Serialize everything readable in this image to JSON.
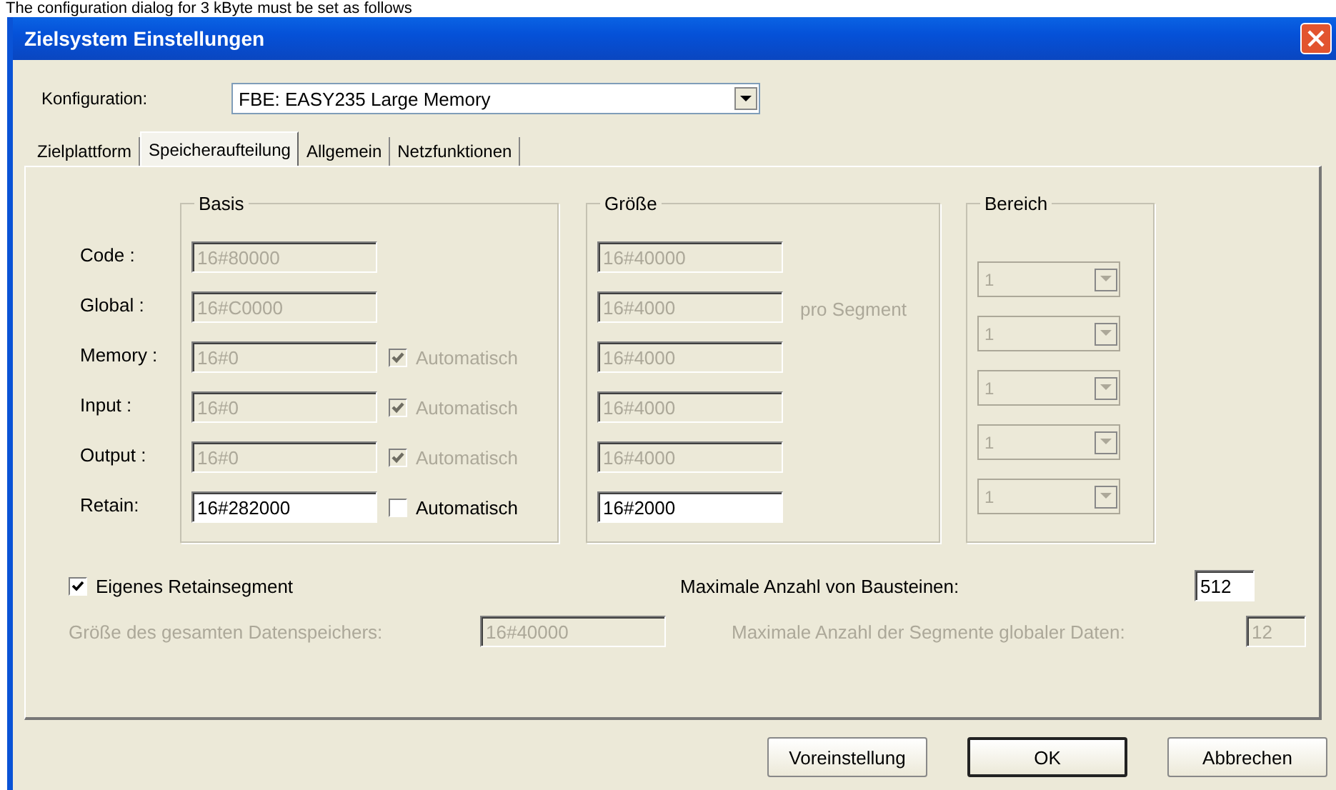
{
  "caption": "The configuration dialog for 3 kByte must be set as follows",
  "window": {
    "title": "Zielsystem Einstellungen"
  },
  "configuration": {
    "label": "Konfiguration:",
    "value": "FBE: EASY235 Large Memory"
  },
  "tabs": [
    {
      "label": "Zielplattform",
      "selected": false
    },
    {
      "label": "Speicheraufteilung",
      "selected": true
    },
    {
      "label": "Allgemein",
      "selected": false
    },
    {
      "label": "Netzfunktionen",
      "selected": false
    }
  ],
  "groups": {
    "basis": "Basis",
    "size": "Größe",
    "range": "Bereich"
  },
  "rows": [
    {
      "label": "Code :",
      "basis": {
        "value": "16#80000",
        "disabled": true
      },
      "size": {
        "value": "16#40000",
        "disabled": true
      }
    },
    {
      "label": "Global :",
      "basis": {
        "value": "16#C0000",
        "disabled": true
      },
      "size": {
        "value": "16#4000",
        "disabled": true
      },
      "note": "pro Segment"
    },
    {
      "label": "Memory :",
      "basis": {
        "value": "16#0",
        "disabled": true
      },
      "auto": {
        "label": "Automatisch",
        "checked": true,
        "disabled": true
      },
      "size": {
        "value": "16#4000",
        "disabled": true
      }
    },
    {
      "label": "Input :",
      "basis": {
        "value": "16#0",
        "disabled": true
      },
      "auto": {
        "label": "Automatisch",
        "checked": true,
        "disabled": true
      },
      "size": {
        "value": "16#4000",
        "disabled": true
      }
    },
    {
      "label": "Output :",
      "basis": {
        "value": "16#0",
        "disabled": true
      },
      "auto": {
        "label": "Automatisch",
        "checked": true,
        "disabled": true
      },
      "size": {
        "value": "16#4000",
        "disabled": true
      }
    },
    {
      "label": "Retain:",
      "basis": {
        "value": "16#282000",
        "disabled": false
      },
      "auto": {
        "label": "Automatisch",
        "checked": false,
        "disabled": false
      },
      "size": {
        "value": "16#2000",
        "disabled": false
      }
    }
  ],
  "ranges": [
    {
      "value": "1",
      "disabled": true
    },
    {
      "value": "1",
      "disabled": true
    },
    {
      "value": "1",
      "disabled": true
    },
    {
      "value": "1",
      "disabled": true
    },
    {
      "value": "1",
      "disabled": true
    }
  ],
  "retain_segment": {
    "label": "Eigenes Retainsegment",
    "checked": true,
    "disabled": false
  },
  "total_data": {
    "label": "Größe des gesamten Datenspeichers:",
    "value": "16#40000",
    "disabled": true
  },
  "max_blocks": {
    "label": "Maximale Anzahl von Bausteinen:",
    "value": "512",
    "disabled": false
  },
  "max_segments": {
    "label": "Maximale Anzahl der Segmente globaler Daten:",
    "value": "12",
    "disabled": true
  },
  "buttons": [
    {
      "label": "Voreinstellung",
      "default": false
    },
    {
      "label": "OK",
      "default": true
    },
    {
      "label": "Abbrechen",
      "default": false
    }
  ]
}
